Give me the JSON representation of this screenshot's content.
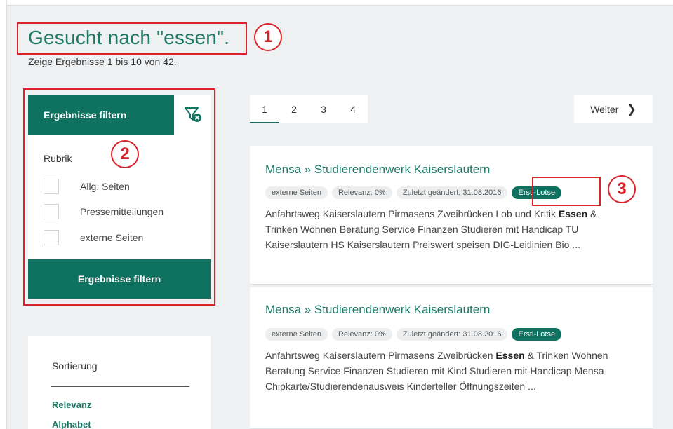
{
  "header": {
    "title": "Gesucht nach \"essen\".",
    "subtitle": "Zeige Ergebnisse 1 bis 10 von 42."
  },
  "filter": {
    "header_label": "Ergebnisse filtern",
    "section_label": "Rubrik",
    "options": [
      "Allg. Seiten",
      "Pressemitteilungen",
      "externe Seiten"
    ],
    "button_label": "Ergebnisse filtern"
  },
  "sort": {
    "title": "Sortierung",
    "options": [
      "Relevanz",
      "Alphabet"
    ]
  },
  "pagination": {
    "pages": [
      "1",
      "2",
      "3",
      "4"
    ],
    "active": "1",
    "next_label": "Weiter"
  },
  "results": [
    {
      "title": "Mensa » Studierendenwerk Kaiserslautern",
      "tags": [
        "externe Seiten",
        "Relevanz: 0%",
        "Zuletzt geändert: 31.08.2016"
      ],
      "badge": "Ersti-Lotse",
      "text_parts": [
        "Anfahrtsweg Kaiserslautern Pirmasens Zweibrücken Lob und Kritik ",
        "Essen",
        " & Trinken Wohnen Beratung Service Finanzen Studieren mit Handicap TU Kaiserslautern HS Kaiserslautern Preiswert speisen DIG-Leitlinien Bio ..."
      ]
    },
    {
      "title": "Mensa » Studierendenwerk Kaiserslautern",
      "tags": [
        "externe Seiten",
        "Relevanz: 0%",
        "Zuletzt geändert: 31.08.2016"
      ],
      "badge": "Ersti-Lotse",
      "text_parts": [
        "Anfahrtsweg Kaiserslautern Pirmasens Zweibrücken ",
        "Essen",
        " & Trinken Wohnen Beratung Service Finanzen Studieren mit Kind Studieren mit Handicap Mensa Chipkarte/Studierendenausweis Kinderteller Öffnungszeiten ..."
      ]
    }
  ],
  "annotations": [
    "1",
    "2",
    "3"
  ],
  "colors": {
    "accent": "#0f7260",
    "title_green": "#1a7a66",
    "annotation_red": "#d8232a"
  }
}
